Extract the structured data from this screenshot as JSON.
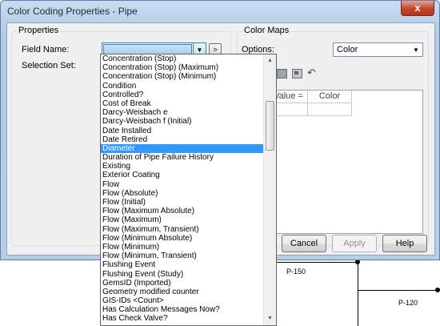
{
  "window": {
    "title": "Color Coding Properties - Pipe",
    "close_glyph": "x"
  },
  "properties": {
    "group_title": "Properties",
    "field_name_label": "Field Name:",
    "field_name_value": "",
    "browse_glyph": ">",
    "selection_set_label": "Selection Set:"
  },
  "color_maps": {
    "group_title": "Color Maps",
    "options_label": "Options:",
    "options_value": "Color",
    "toolbar_icons": [
      "new-icon",
      "delete-icon",
      "undo-icon"
    ],
    "grid_headers": [
      "Value =",
      "Color"
    ]
  },
  "buttons": {
    "cancel": "Cancel",
    "apply": "Apply",
    "help": "Help"
  },
  "dropdown": {
    "selected": "Diameter",
    "items": [
      "Concentration (Stop)",
      "Concentration (Stop) (Maximum)",
      "Concentration (Stop) (Minimum)",
      "Condition",
      "Controlled?",
      "Cost of Break",
      "Darcy-Weisbach e",
      "Darcy-Weisbach f (Initial)",
      "Date Installed",
      "Date Retired",
      "Diameter",
      "Duration of Pipe Failure History",
      "Existing",
      "Exterior Coating",
      "Flow",
      "Flow (Absolute)",
      "Flow (Initial)",
      "Flow (Maximum Absolute)",
      "Flow (Maximum)",
      "Flow (Maximum, Transient)",
      "Flow (Minimum Absolute)",
      "Flow (Minimum)",
      "Flow (Minimum, Transient)",
      "Flushing Event",
      "Flushing Event (Study)",
      "GemsID (Imported)",
      "Geometry modified counter",
      "GIS-IDs <Count>",
      "Has Calculation Messages Now?",
      "Has Check Valve?"
    ]
  },
  "drawing": {
    "pipe_labels": [
      "P-150",
      "P-120"
    ]
  },
  "colors": {
    "selection": "#3399ff",
    "title_bar": "#b9d1ea",
    "close_button": "#c7422a"
  }
}
